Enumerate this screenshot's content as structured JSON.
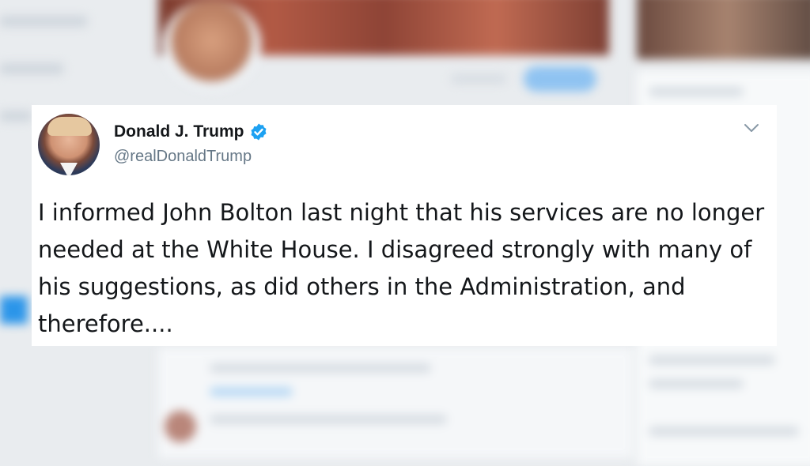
{
  "tweet": {
    "author_name": "Donald J. Trump",
    "handle": "@realDonaldTrump",
    "text": "I informed John Bolton last night that his services are no longer needed at the White House. I disagreed strongly with many of his suggestions, as did others in the Administration, and therefore....",
    "verified_icon": "verified-badge-icon",
    "menu_icon": "chevron-down-icon"
  },
  "colors": {
    "verified_blue": "#1da1f2",
    "name_text": "#14171a",
    "handle_text": "#657786",
    "card_background": "#ffffff"
  }
}
